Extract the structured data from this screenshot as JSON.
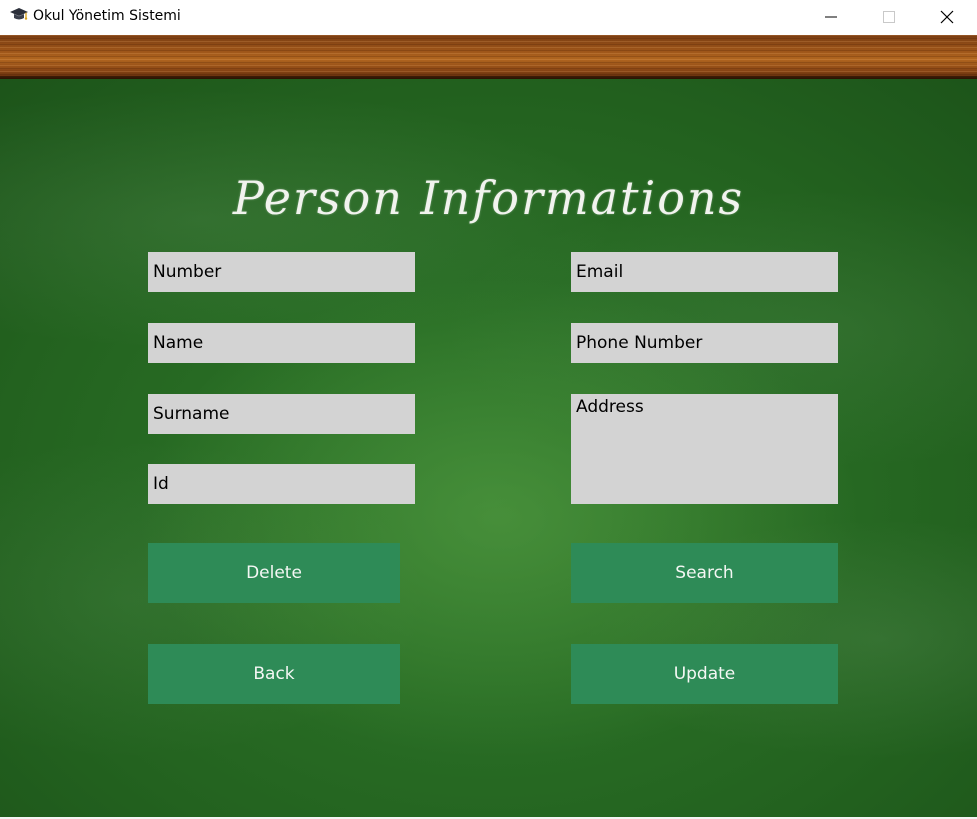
{
  "window": {
    "title": "Okul Yönetim Sistemi",
    "icon": "graduation-cap-icon",
    "controls": [
      "minimize-icon",
      "maximize-icon",
      "close-icon"
    ]
  },
  "page": {
    "heading": "Person Informations"
  },
  "form": {
    "number": {
      "placeholder": "Number",
      "value": ""
    },
    "name": {
      "placeholder": "Name",
      "value": ""
    },
    "surname": {
      "placeholder": "Surname",
      "value": ""
    },
    "id": {
      "placeholder": "Id",
      "value": ""
    },
    "email": {
      "placeholder": "Email",
      "value": ""
    },
    "phone": {
      "placeholder": "Phone Number",
      "value": ""
    },
    "address": {
      "placeholder": "Address",
      "value": ""
    }
  },
  "buttons": {
    "delete": "Delete",
    "search": "Search",
    "back": "Back",
    "update": "Update"
  },
  "colors": {
    "board": "#23621f",
    "field_bg": "#d3d3d3",
    "button_bg": "#2e8b57",
    "button_text": "#f4f7f4",
    "wood": "#9c5419"
  }
}
